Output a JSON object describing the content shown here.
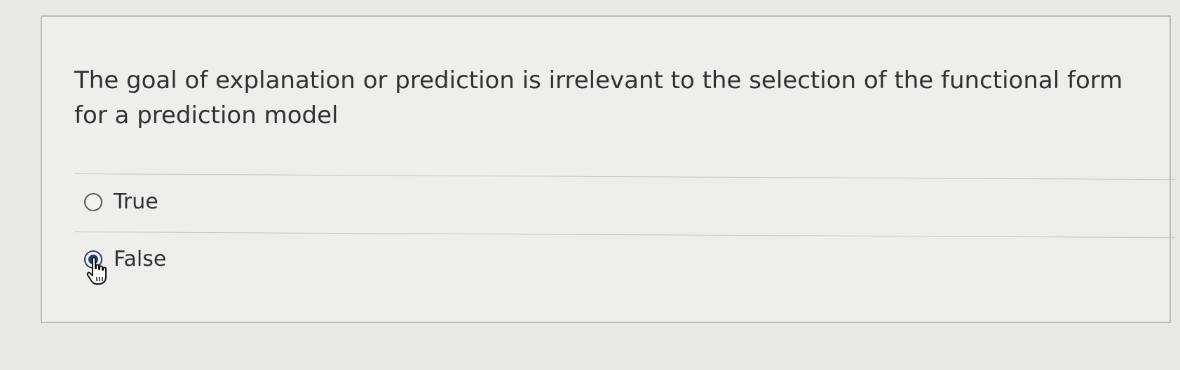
{
  "question": {
    "text": "The goal of explanation or prediction is irrelevant to the selection of the functional form for a prediction model"
  },
  "answers": [
    {
      "label": "True",
      "selected": false
    },
    {
      "label": "False",
      "selected": true
    }
  ],
  "icons": {
    "cursor": "hand-pointer-icon"
  },
  "colors": {
    "selected_radio": "#1d3e78",
    "text": "#2f3133"
  }
}
